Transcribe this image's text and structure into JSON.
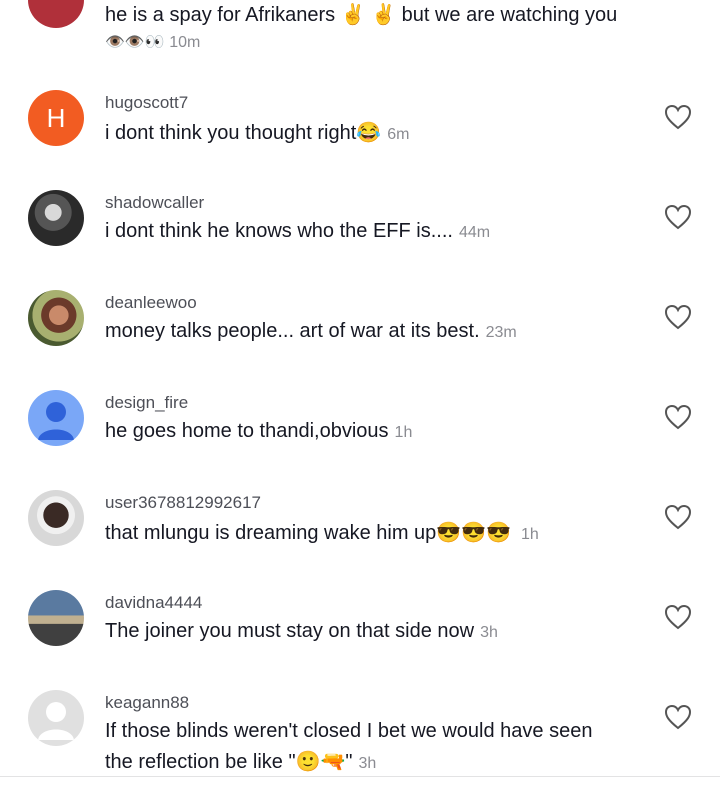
{
  "comments": [
    {
      "username": "",
      "text": "he is a spay for Afrikaners ✌️ ✌️ but we are watching you",
      "reactions": "👁️👁️👀",
      "time": "10m"
    },
    {
      "username": "hugoscott7",
      "avatar_letter": "H",
      "text": "i dont think you thought right😂",
      "time": "6m"
    },
    {
      "username": "shadowcaller",
      "text": "i dont think he knows who the EFF is....",
      "time": "44m"
    },
    {
      "username": "deanleewoo",
      "text": "money talks people... art of war at its best.",
      "time": "23m"
    },
    {
      "username": "design_fire",
      "text": "he goes home to thandi,obvious",
      "time": "1h"
    },
    {
      "username": "user3678812992617",
      "text": "that mlungu is dreaming wake him up😎😎😎",
      "time": "1h"
    },
    {
      "username": "davidna4444",
      "text": "The joiner you must stay on that side now",
      "time": "3h"
    },
    {
      "username": "keagann88",
      "text_line1": "If those blinds weren't closed I bet we would have seen",
      "text_line2": "the reflection be like \"🙂🔫\"",
      "time": "3h"
    }
  ],
  "icons": {
    "like": "heart-outline-icon",
    "collapse": "chevron-down-icon"
  },
  "colors": {
    "text": "#161823",
    "meta": "#8a8b91",
    "username": "#4d4f57",
    "h_avatar": "#f25c22"
  }
}
